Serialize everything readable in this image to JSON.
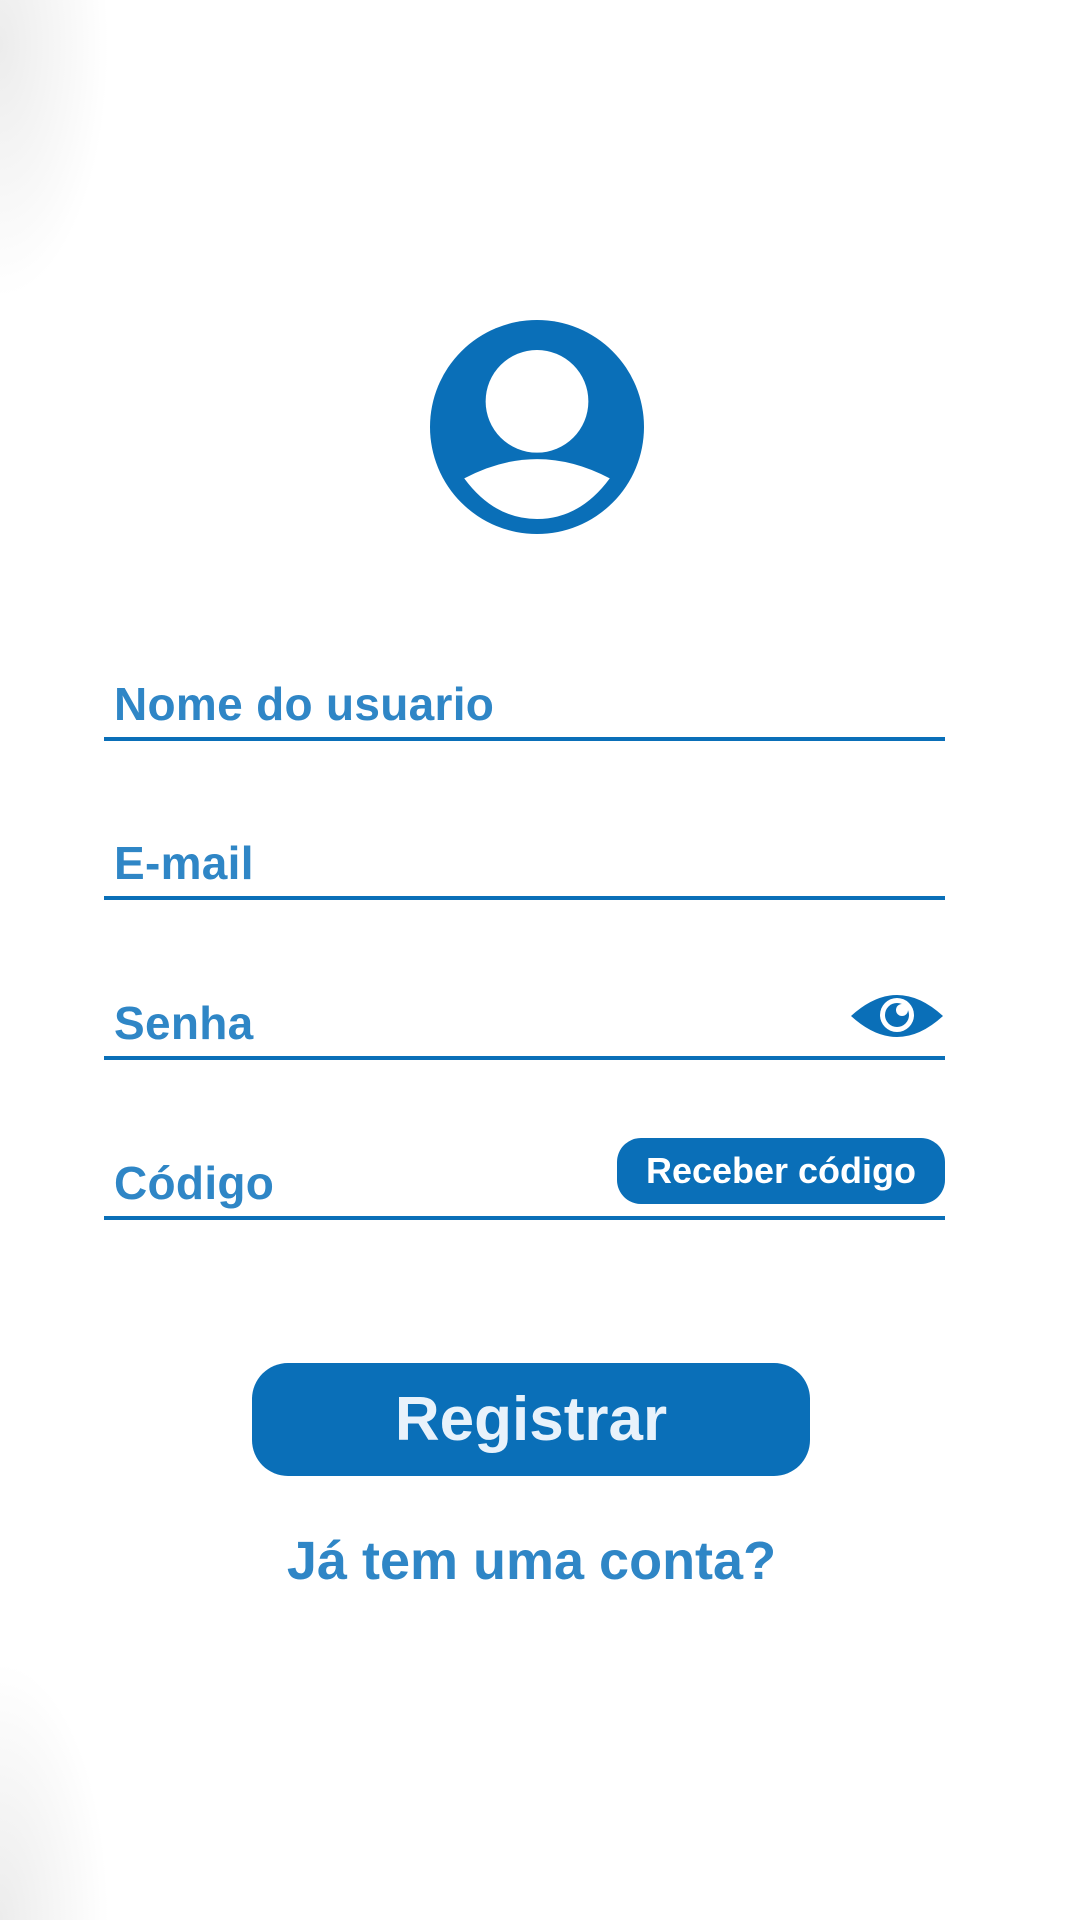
{
  "colors": {
    "primary": "#0a6fb8",
    "label_text": "#2f86c6",
    "background": "#ffffff"
  },
  "icons": {
    "avatar": "user-icon",
    "password_toggle": "eye-icon"
  },
  "form": {
    "username": {
      "placeholder": "Nome do usuario"
    },
    "email": {
      "placeholder": "E-mail"
    },
    "password": {
      "placeholder": "Senha"
    },
    "code": {
      "placeholder": "Código",
      "button_label": "Receber código"
    }
  },
  "actions": {
    "register_label": "Registrar",
    "login_link": "Já tem uma conta?"
  }
}
